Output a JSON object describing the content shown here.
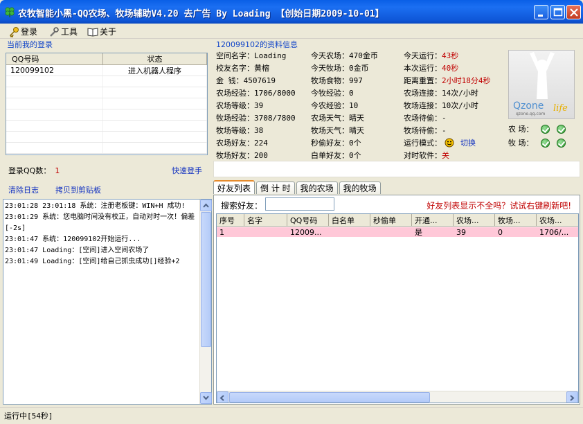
{
  "window": {
    "title": "农牧智能小黑-QQ农场、牧场辅助V4.20  去广告 By Loading  【创始日期2009-10-01】"
  },
  "menu": {
    "login": "登录",
    "tools": "工具",
    "about": "关于"
  },
  "login_panel": {
    "label": "当前我的登录",
    "columns": [
      "QQ号码",
      "状态"
    ],
    "rows": [
      {
        "qq": "120099102",
        "status": "进入机器人程序"
      }
    ],
    "qq_count_label": "登录QQ数：",
    "qq_count": "1",
    "quick_login": "快速登手"
  },
  "log_actions": {
    "clear": "清除日志",
    "copy": "拷贝到剪贴板"
  },
  "log_lines": [
    "23:01:28 23:01:18 系统：注册老板键：WIN+H 成功!",
    "23:01:29 系统：您电脑时间没有校正，自动对时一次！偏差[-2s]",
    "23:01:47 系统：120099102开始运行...",
    "23:01:47 Loading：[空间]进入空间农场了",
    "23:01:49 Loading：[空间]给自己抓虫成功[]经验+2"
  ],
  "info": {
    "label": "120099102的资料信息",
    "col1": [
      {
        "label": "空间名字：",
        "value": "Loading"
      },
      {
        "label": "校友名字：",
        "value": "黄榕"
      },
      {
        "label": "金    钱：",
        "value": "4507619"
      },
      {
        "label": "农场经验：",
        "value": "1706/8000"
      },
      {
        "label": "农场等级：",
        "value": "39"
      },
      {
        "label": "牧场经验：",
        "value": "3708/7800"
      },
      {
        "label": "牧场等级：",
        "value": "38"
      },
      {
        "label": "农场好友：",
        "value": "224"
      },
      {
        "label": "牧场好友：",
        "value": "200"
      }
    ],
    "col2": [
      {
        "label": "今天农场：",
        "value": "470金币"
      },
      {
        "label": "今天牧场：",
        "value": "0金币"
      },
      {
        "label": "牧场食物：",
        "value": "997"
      },
      {
        "label": "今牧经验：",
        "value": "0"
      },
      {
        "label": "今农经验：",
        "value": "10"
      },
      {
        "label": "农场天气：",
        "value": "晴天"
      },
      {
        "label": "牧场天气：",
        "value": "晴天"
      },
      {
        "label": "秒偷好友：",
        "value": "0个"
      },
      {
        "label": "白单好友：",
        "value": "0个"
      }
    ],
    "col3": [
      {
        "label": "今天运行：",
        "value": "43秒"
      },
      {
        "label": "本次运行：",
        "value": "40秒"
      },
      {
        "label": "距离重置：",
        "value": "2小时18分4秒"
      },
      {
        "label": "农场连接：",
        "value": "14次/小时"
      },
      {
        "label": "牧场连接：",
        "value": "10次/小时"
      },
      {
        "label": "农场待偷：",
        "value": "-"
      },
      {
        "label": "牧场待偷：",
        "value": "-"
      },
      {
        "label": "运行模式：",
        "value": "切换"
      },
      {
        "label": "对时软件：",
        "value": "关"
      }
    ],
    "avatar_brand": "Qzone",
    "avatar_site": "qzone.qq.com",
    "avatar_life": "life",
    "farm_label": "农  场：",
    "ranch_label": "牧  场："
  },
  "tabs": [
    "好友列表",
    "倒 计 时",
    "我的农场",
    "我的牧场"
  ],
  "friends": {
    "search_label": "搜索好友：",
    "search_value": "",
    "refresh_tip": "好友列表显示不全吗？试试右键刷新吧!",
    "columns": [
      "序号",
      "名字",
      "QQ号码",
      "白名单",
      "秒偷单",
      "开通...",
      "农场...",
      "牧场...",
      "农场..."
    ],
    "rows": [
      [
        "1",
        "",
        "12009...",
        "",
        "",
        "是",
        "39",
        "0",
        "1706/..."
      ]
    ]
  },
  "status": {
    "text": "运行中[54秒]"
  },
  "colors": {
    "titlebar": "#0a5fe6",
    "link": "#1030c0",
    "red": "#c00000",
    "row_highlight": "#ffc8d8"
  }
}
